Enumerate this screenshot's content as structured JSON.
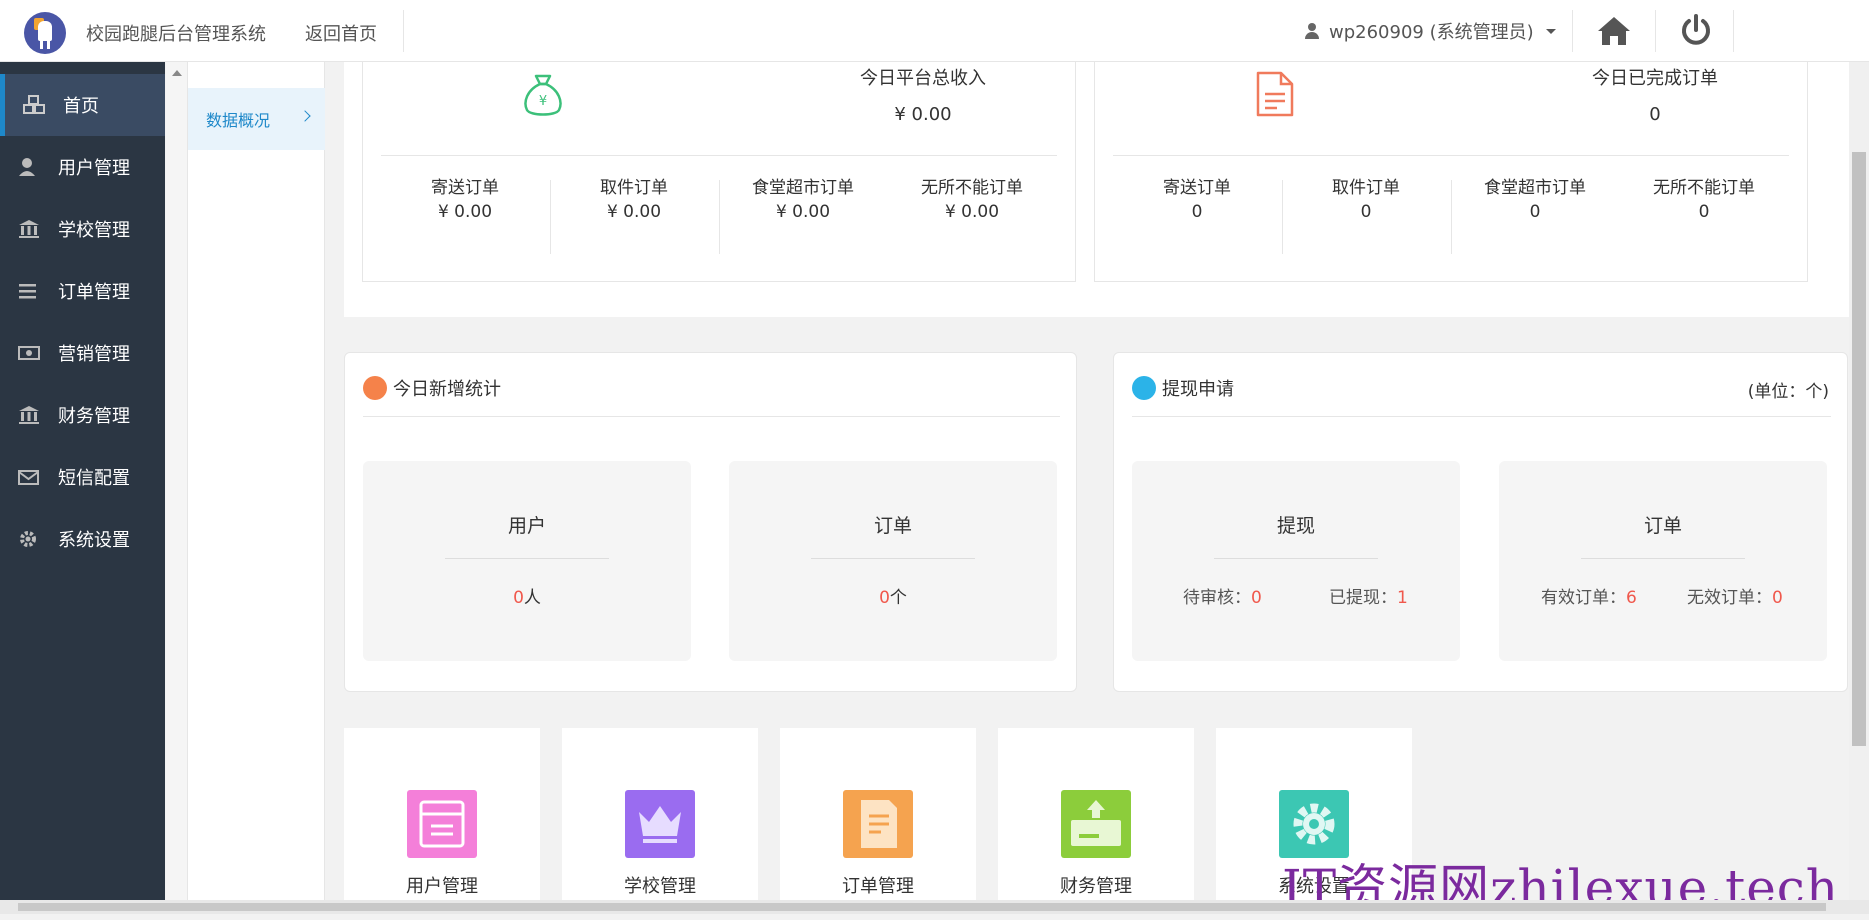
{
  "header": {
    "app_title": "校园跑腿后台管理系统",
    "back_home": "返回首页",
    "user_label": "wp260909 (系统管理员)"
  },
  "sidebar": {
    "items": [
      {
        "label": "首页",
        "icon": "cubes-icon"
      },
      {
        "label": "用户管理",
        "icon": "user-icon"
      },
      {
        "label": "学校管理",
        "icon": "bank-icon"
      },
      {
        "label": "订单管理",
        "icon": "list-icon"
      },
      {
        "label": "营销管理",
        "icon": "money-icon"
      },
      {
        "label": "财务管理",
        "icon": "bank-icon"
      },
      {
        "label": "短信配置",
        "icon": "envelope-icon"
      },
      {
        "label": "系统设置",
        "icon": "gear-icon"
      }
    ]
  },
  "submenu": {
    "item": "数据概况"
  },
  "income": {
    "title": "今日平台总收入",
    "value": "¥ 0.00",
    "cells": [
      {
        "label": "寄送订单",
        "value": "¥ 0.00"
      },
      {
        "label": "取件订单",
        "value": "¥ 0.00"
      },
      {
        "label": "食堂超市订单",
        "value": "¥ 0.00"
      },
      {
        "label": "无所不能订单",
        "value": "¥ 0.00"
      }
    ]
  },
  "completed": {
    "title": "今日已完成订单",
    "value": "0",
    "cells": [
      {
        "label": "寄送订单",
        "value": "0"
      },
      {
        "label": "取件订单",
        "value": "0"
      },
      {
        "label": "食堂超市订单",
        "value": "0"
      },
      {
        "label": "无所不能订单",
        "value": "0"
      }
    ]
  },
  "new_stats": {
    "title": "今日新增统计",
    "users": {
      "title": "用户",
      "count": "0",
      "unit": "人"
    },
    "orders": {
      "title": "订单",
      "count": "0",
      "unit": "个"
    }
  },
  "withdraw": {
    "title": "提现申请",
    "unit": "(单位：个)",
    "withdraw_tile": {
      "title": "提现",
      "pending_label": "待审核：",
      "pending": "0",
      "done_label": "已提现：",
      "done": "1"
    },
    "order_tile": {
      "title": "订单",
      "valid_label": "有效订单：",
      "valid": "6",
      "invalid_label": "无效订单：",
      "invalid": "0"
    }
  },
  "quick_links": [
    {
      "label": "用户管理",
      "color": "#f47fd9"
    },
    {
      "label": "学校管理",
      "color": "#9a6cf0"
    },
    {
      "label": "订单管理",
      "color": "#f5a34f"
    },
    {
      "label": "财务管理",
      "color": "#8ccd3b"
    },
    {
      "label": "系统设置",
      "color": "#3cc7b3"
    }
  ],
  "watermark": "IT资源网zhilexue.tech",
  "colors": {
    "sidebar": "#2b3643",
    "accent": "#1e88c9",
    "red": "#f0584c"
  }
}
